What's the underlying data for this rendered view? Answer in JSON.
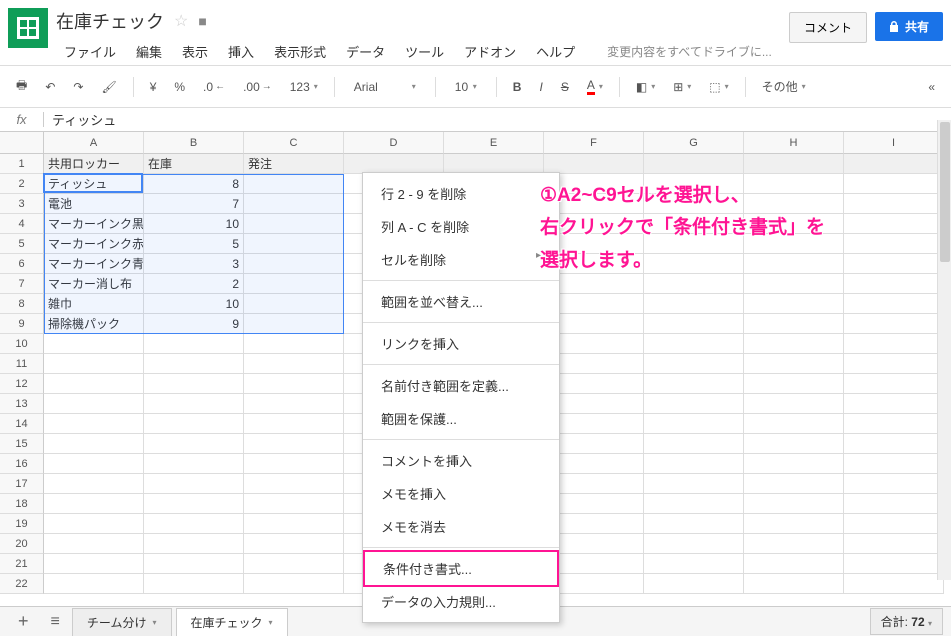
{
  "doc": {
    "title": "在庫チェック"
  },
  "menubar": [
    "ファイル",
    "編集",
    "表示",
    "挿入",
    "表示形式",
    "データ",
    "ツール",
    "アドオン",
    "ヘルプ"
  ],
  "save_status": "変更内容をすべてドライブに...",
  "buttons": {
    "comment": "コメント",
    "share": "共有"
  },
  "toolbar": {
    "currency": "¥",
    "percent": "%",
    "dec_dec": ".0←",
    "dec_inc": ".00→",
    "num_format": "123",
    "font": "Arial",
    "size": "10",
    "other": "その他"
  },
  "fx": {
    "value": "ティッシュ"
  },
  "columns": [
    "A",
    "B",
    "C",
    "D",
    "E",
    "F",
    "G",
    "H",
    "I"
  ],
  "rows_count": 22,
  "data": {
    "headers": [
      "共用ロッカー",
      "在庫",
      "発注"
    ],
    "rows": [
      [
        "ティッシュ",
        "8",
        ""
      ],
      [
        "電池",
        "7",
        ""
      ],
      [
        "マーカーインク黒",
        "10",
        ""
      ],
      [
        "マーカーインク赤",
        "5",
        ""
      ],
      [
        "マーカーインク青",
        "3",
        ""
      ],
      [
        "マーカー消し布",
        "2",
        ""
      ],
      [
        "雑巾",
        "10",
        ""
      ],
      [
        "掃除機パック",
        "9",
        ""
      ]
    ]
  },
  "context_menu": {
    "items": [
      {
        "label": "行 2 - 9 を削除"
      },
      {
        "label": "列 A - C を削除"
      },
      {
        "label": "セルを削除",
        "arrow": true
      },
      {
        "sep": true
      },
      {
        "label": "範囲を並べ替え..."
      },
      {
        "sep": true
      },
      {
        "label": "リンクを挿入"
      },
      {
        "sep": true
      },
      {
        "label": "名前付き範囲を定義..."
      },
      {
        "label": "範囲を保護..."
      },
      {
        "sep": true
      },
      {
        "label": "コメントを挿入"
      },
      {
        "label": "メモを挿入"
      },
      {
        "label": "メモを消去"
      },
      {
        "sep": true
      },
      {
        "label": "条件付き書式...",
        "highlight": true
      },
      {
        "label": "データの入力規則..."
      }
    ]
  },
  "annotation": {
    "line1": "①A2~C9セルを選択し、",
    "line2": "右クリックで「条件付き書式」を",
    "line3": "選択します。"
  },
  "tabs": [
    {
      "name": "チーム分け",
      "active": false
    },
    {
      "name": "在庫チェック",
      "active": true
    }
  ],
  "sum": {
    "label": "合計:",
    "value": "72"
  }
}
